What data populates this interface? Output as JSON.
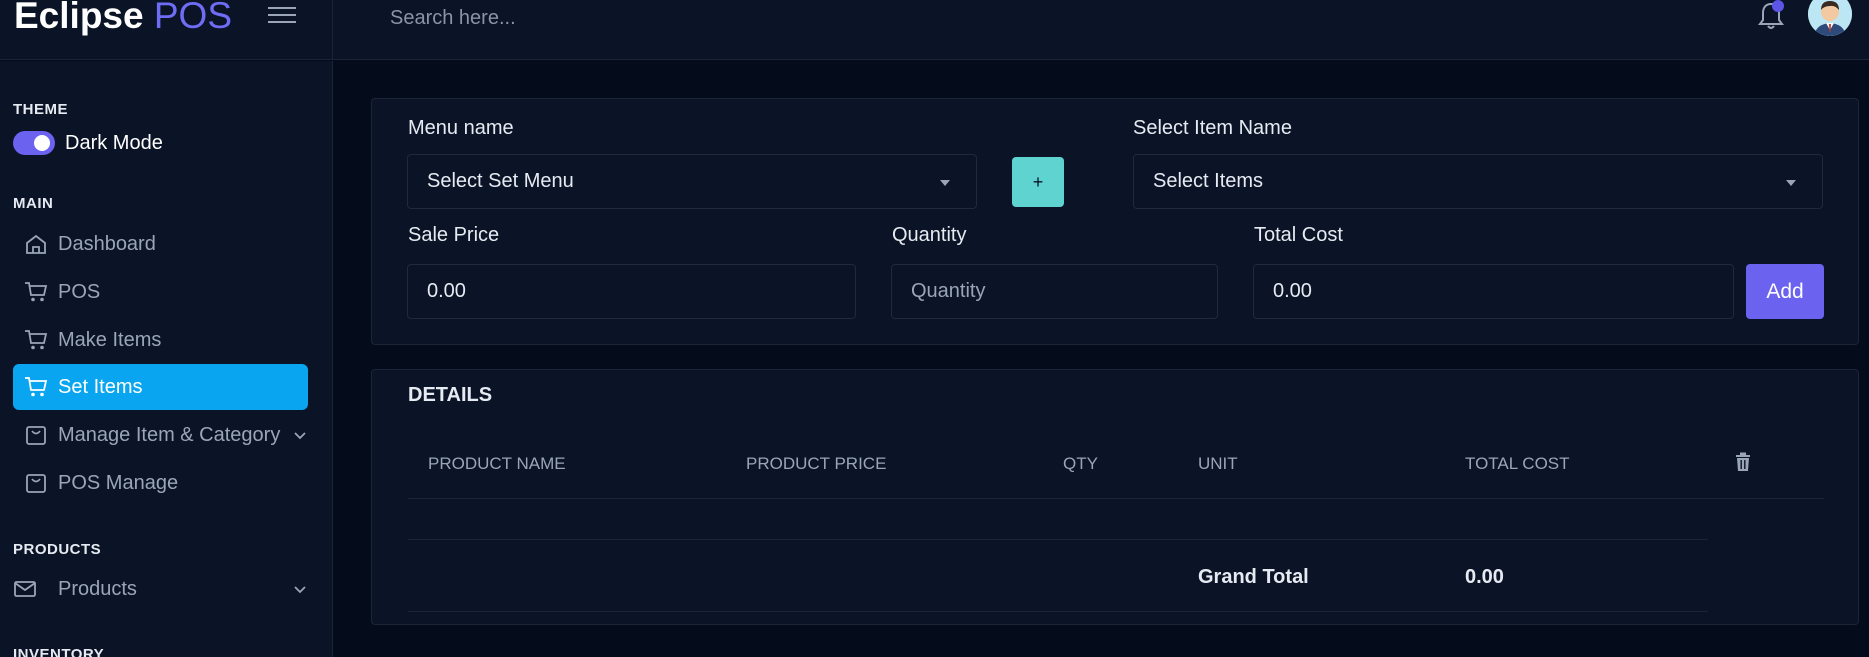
{
  "app": {
    "brand_main": "Eclipse",
    "brand_accent": "POS"
  },
  "header": {
    "search_placeholder": "Search here..."
  },
  "sidebar": {
    "theme_title": "THEME",
    "dark_mode_label": "Dark Mode",
    "dark_mode_on": true,
    "main_title": "MAIN",
    "items": [
      {
        "label": "Dashboard",
        "icon": "home-icon"
      },
      {
        "label": "POS",
        "icon": "cart-icon"
      },
      {
        "label": "Make Items",
        "icon": "cart-icon"
      },
      {
        "label": "Set Items",
        "icon": "cart-icon",
        "active": true
      },
      {
        "label": "Manage Item & Category",
        "icon": "bag-icon"
      },
      {
        "label": "POS Manage",
        "icon": "bag-icon"
      }
    ],
    "products_title": "PRODUCTS",
    "products_item": {
      "label": "Products",
      "icon": "mail-icon"
    },
    "inventory_title": "INVENTORY"
  },
  "form": {
    "menu_name_label": "Menu name",
    "menu_select_value": "Select Set Menu",
    "plus_label": "+",
    "item_name_label": "Select Item Name",
    "item_select_value": "Select Items",
    "sale_price_label": "Sale Price",
    "sale_price_value": "0.00",
    "quantity_label": "Quantity",
    "quantity_placeholder": "Quantity",
    "total_cost_label": "Total Cost",
    "total_cost_value": "0.00",
    "add_label": "Add"
  },
  "details": {
    "title": "DETAILS",
    "columns": [
      "PRODUCT NAME",
      "PRODUCT PRICE",
      "QTY",
      "UNIT",
      "TOTAL COST"
    ],
    "grand_total_label": "Grand Total",
    "grand_total_value": "0.00"
  },
  "colors": {
    "accent": "#6b63f0",
    "active_nav": "#0aa5f0",
    "teal_button": "#5fd3d0",
    "background": "#040b1a",
    "panel": "#0b1326"
  }
}
